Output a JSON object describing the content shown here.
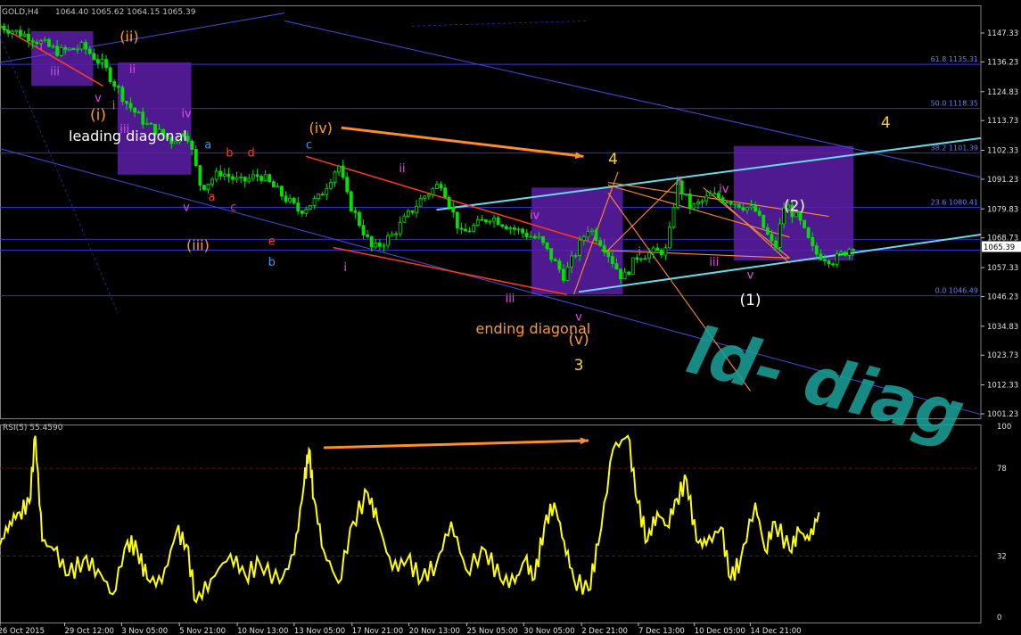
{
  "colors": {
    "background": "#000000",
    "frame": "#808080",
    "price_level_line": "#3b3bd6",
    "fib_text": "#6f78ff",
    "candles": "#00e100",
    "rsi_line": "#ffff00",
    "rsi_level": "#8b0000",
    "channel_cyan": "#66d9e8",
    "trend_red": "#ff3b1a",
    "trend_orange": "#ff8c2a",
    "box_purple": "#5d1ea8",
    "watermark": "#1aa39a",
    "label_white": "#ffffff",
    "label_orange": "#ff9a26",
    "label_yellow": "#ffd21f",
    "label_magenta": "#e24de0",
    "label_blue": "#2f9bff",
    "label_red": "#ff3b1a"
  },
  "chart_data": [
    {
      "type": "candlestick",
      "title": "GOLD,H4",
      "ohlc_header": "1064.40 1065.62 1064.15 1065.39",
      "current_price": "1065.39",
      "y_ticks": [
        "1147.33",
        "1136.23",
        "1124.83",
        "1113.73",
        "1102.33",
        "1091.23",
        "1079.83",
        "1068.73",
        "1057.33",
        "1046.23",
        "1034.83",
        "1023.73",
        "1012.33",
        "1001.23"
      ],
      "ylim": [
        1001.23,
        1147.33
      ],
      "x_ticks": [
        "26 Oct 2015",
        "29 Oct 12:00",
        "3 Nov 05:00",
        "5 Nov 21:00",
        "10 Nov 13:00",
        "13 Nov 05:00",
        "17 Nov 21:00",
        "20 Nov 13:00",
        "25 Nov 05:00",
        "30 Nov 05:00",
        "2 Dec 21:00",
        "7 Dec 13:00",
        "10 Dec 05:00",
        "14 Dec 21:00"
      ],
      "fib_levels": [
        {
          "label": "61.8 1135.31",
          "value": 1135.31
        },
        {
          "label": "50.0 1118.35",
          "value": 1118.35
        },
        {
          "label": "38.2 1101.39",
          "value": 1101.39
        },
        {
          "label": "23.6 1080.41",
          "value": 1080.41
        },
        {
          "label": "0.0 1046.49",
          "value": 1046.49
        }
      ],
      "horizontal_levels": [
        1068.2,
        1064.0
      ],
      "price_path": [
        [
          0.0,
          1150
        ],
        [
          0.03,
          1146
        ],
        [
          0.06,
          1140
        ],
        [
          0.085,
          1142
        ],
        [
          0.105,
          1135
        ],
        [
          0.13,
          1120
        ],
        [
          0.15,
          1112
        ],
        [
          0.175,
          1106
        ],
        [
          0.19,
          1110
        ],
        [
          0.205,
          1088
        ],
        [
          0.225,
          1094
        ],
        [
          0.245,
          1090
        ],
        [
          0.265,
          1093
        ],
        [
          0.285,
          1086
        ],
        [
          0.305,
          1079
        ],
        [
          0.325,
          1084
        ],
        [
          0.345,
          1097
        ],
        [
          0.355,
          1083
        ],
        [
          0.38,
          1064
        ],
        [
          0.4,
          1070
        ],
        [
          0.43,
          1084
        ],
        [
          0.45,
          1090
        ],
        [
          0.47,
          1070
        ],
        [
          0.5,
          1077
        ],
        [
          0.525,
          1072
        ],
        [
          0.55,
          1068
        ],
        [
          0.575,
          1054
        ],
        [
          0.6,
          1073
        ],
        [
          0.615,
          1066
        ],
        [
          0.635,
          1053
        ],
        [
          0.65,
          1062
        ],
        [
          0.68,
          1064
        ],
        [
          0.69,
          1090
        ],
        [
          0.705,
          1080
        ],
        [
          0.725,
          1085
        ],
        [
          0.745,
          1083
        ],
        [
          0.77,
          1079
        ],
        [
          0.79,
          1064
        ],
        [
          0.8,
          1082
        ],
        [
          0.815,
          1075
        ],
        [
          0.83,
          1063
        ],
        [
          0.85,
          1060
        ],
        [
          0.87,
          1066
        ]
      ],
      "annotations": [
        {
          "text": "leading diagonal",
          "color": "label_white",
          "x": 0.07,
          "y": 1106
        },
        {
          "text": "ending diagonal",
          "color": "label_orange",
          "x": 0.485,
          "y": 1032
        },
        {
          "text": "(ii)",
          "color": "label_orange",
          "x": 0.122,
          "y": 1144
        },
        {
          "text": "(i)",
          "color": "label_orange",
          "x": 0.1,
          "y": 1114
        },
        {
          "text": "(iii)",
          "color": "label_orange",
          "x": 0.19,
          "y": 1064
        },
        {
          "text": "(iv)",
          "color": "label_orange",
          "x": 0.315,
          "y": 1109
        },
        {
          "text": "(v)",
          "color": "label_orange",
          "x": 0.59,
          "y": 1028
        },
        {
          "text": "3",
          "color": "label_yellow",
          "x": 0.59,
          "y": 1018
        },
        {
          "text": "4",
          "color": "label_yellow",
          "x": 0.625,
          "y": 1097
        },
        {
          "text": "4",
          "color": "label_yellow",
          "x": 0.903,
          "y": 1111
        },
        {
          "text": "(2)",
          "color": "label_white",
          "x": 0.81,
          "y": 1079
        },
        {
          "text": "(1)",
          "color": "label_white",
          "x": 0.765,
          "y": 1043
        },
        {
          "text": "i",
          "color": "label_magenta",
          "x": 0.042,
          "y": 1141
        },
        {
          "text": "iii",
          "color": "label_magenta",
          "x": 0.056,
          "y": 1131
        },
        {
          "text": "ii",
          "color": "label_magenta",
          "x": 0.135,
          "y": 1132
        },
        {
          "text": "v",
          "color": "label_magenta",
          "x": 0.1,
          "y": 1121
        },
        {
          "text": "i",
          "color": "label_magenta",
          "x": 0.116,
          "y": 1118
        },
        {
          "text": "iii",
          "color": "label_magenta",
          "x": 0.127,
          "y": 1109
        },
        {
          "text": "iv",
          "color": "label_magenta",
          "x": 0.19,
          "y": 1115
        },
        {
          "text": "v",
          "color": "label_magenta",
          "x": 0.19,
          "y": 1079
        },
        {
          "text": "a",
          "color": "label_blue",
          "x": 0.212,
          "y": 1103
        },
        {
          "text": "b",
          "color": "label_red",
          "x": 0.234,
          "y": 1100
        },
        {
          "text": "d",
          "color": "label_red",
          "x": 0.256,
          "y": 1100
        },
        {
          "text": "a",
          "color": "label_red",
          "x": 0.216,
          "y": 1083
        },
        {
          "text": "c",
          "color": "label_red",
          "x": 0.238,
          "y": 1079
        },
        {
          "text": "c",
          "color": "label_blue",
          "x": 0.315,
          "y": 1103
        },
        {
          "text": "e",
          "color": "label_red",
          "x": 0.277,
          "y": 1066
        },
        {
          "text": "b",
          "color": "label_blue",
          "x": 0.277,
          "y": 1058
        },
        {
          "text": "ii",
          "color": "label_magenta",
          "x": 0.41,
          "y": 1094
        },
        {
          "text": "i",
          "color": "label_magenta",
          "x": 0.352,
          "y": 1056
        },
        {
          "text": "iv",
          "color": "label_magenta",
          "x": 0.545,
          "y": 1076
        },
        {
          "text": "iii",
          "color": "label_magenta",
          "x": 0.52,
          "y": 1044
        },
        {
          "text": "v",
          "color": "label_magenta",
          "x": 0.59,
          "y": 1037
        },
        {
          "text": "ii",
          "color": "label_magenta",
          "x": 0.692,
          "y": 1089
        },
        {
          "text": "i",
          "color": "label_magenta",
          "x": 0.652,
          "y": 1062
        },
        {
          "text": "iv",
          "color": "label_magenta",
          "x": 0.738,
          "y": 1086
        },
        {
          "text": "iii",
          "color": "label_magenta",
          "x": 0.728,
          "y": 1058
        },
        {
          "text": "v",
          "color": "label_magenta",
          "x": 0.765,
          "y": 1053
        }
      ],
      "watermark": "ld- diag"
    },
    {
      "type": "line",
      "title": "RSI(5) 55.4590",
      "y_ticks": [
        "100",
        "78",
        "32",
        "0"
      ],
      "levels": [
        78,
        32
      ],
      "ylim": [
        0,
        100
      ],
      "series": [
        {
          "values": [
            [
              0.0,
              38
            ],
            [
              0.01,
              50
            ],
            [
              0.02,
              55
            ],
            [
              0.03,
              60
            ],
            [
              0.036,
              95
            ],
            [
              0.043,
              40
            ],
            [
              0.055,
              35
            ],
            [
              0.07,
              22
            ],
            [
              0.085,
              30
            ],
            [
              0.1,
              25
            ],
            [
              0.115,
              12
            ],
            [
              0.13,
              40
            ],
            [
              0.14,
              35
            ],
            [
              0.15,
              20
            ],
            [
              0.165,
              18
            ],
            [
              0.18,
              45
            ],
            [
              0.19,
              38
            ],
            [
              0.2,
              8
            ],
            [
              0.215,
              20
            ],
            [
              0.235,
              33
            ],
            [
              0.25,
              22
            ],
            [
              0.265,
              28
            ],
            [
              0.285,
              18
            ],
            [
              0.3,
              33
            ],
            [
              0.31,
              70
            ],
            [
              0.315,
              88
            ],
            [
              0.32,
              62
            ],
            [
              0.33,
              35
            ],
            [
              0.345,
              18
            ],
            [
              0.36,
              50
            ],
            [
              0.375,
              65
            ],
            [
              0.385,
              50
            ],
            [
              0.4,
              25
            ],
            [
              0.415,
              30
            ],
            [
              0.43,
              20
            ],
            [
              0.445,
              28
            ],
            [
              0.46,
              50
            ],
            [
              0.475,
              25
            ],
            [
              0.495,
              35
            ],
            [
              0.51,
              20
            ],
            [
              0.525,
              18
            ],
            [
              0.535,
              30
            ],
            [
              0.545,
              20
            ],
            [
              0.555,
              48
            ],
            [
              0.565,
              60
            ],
            [
              0.575,
              40
            ],
            [
              0.585,
              20
            ],
            [
              0.6,
              14
            ],
            [
              0.61,
              38
            ],
            [
              0.625,
              88
            ],
            [
              0.64,
              95
            ],
            [
              0.65,
              60
            ],
            [
              0.66,
              40
            ],
            [
              0.67,
              55
            ],
            [
              0.68,
              48
            ],
            [
              0.69,
              62
            ],
            [
              0.7,
              72
            ],
            [
              0.71,
              40
            ],
            [
              0.72,
              38
            ],
            [
              0.735,
              47
            ],
            [
              0.745,
              20
            ],
            [
              0.755,
              30
            ],
            [
              0.77,
              60
            ],
            [
              0.78,
              35
            ],
            [
              0.79,
              50
            ],
            [
              0.805,
              35
            ],
            [
              0.815,
              45
            ],
            [
              0.825,
              40
            ],
            [
              0.835,
              55
            ]
          ]
        }
      ]
    }
  ]
}
